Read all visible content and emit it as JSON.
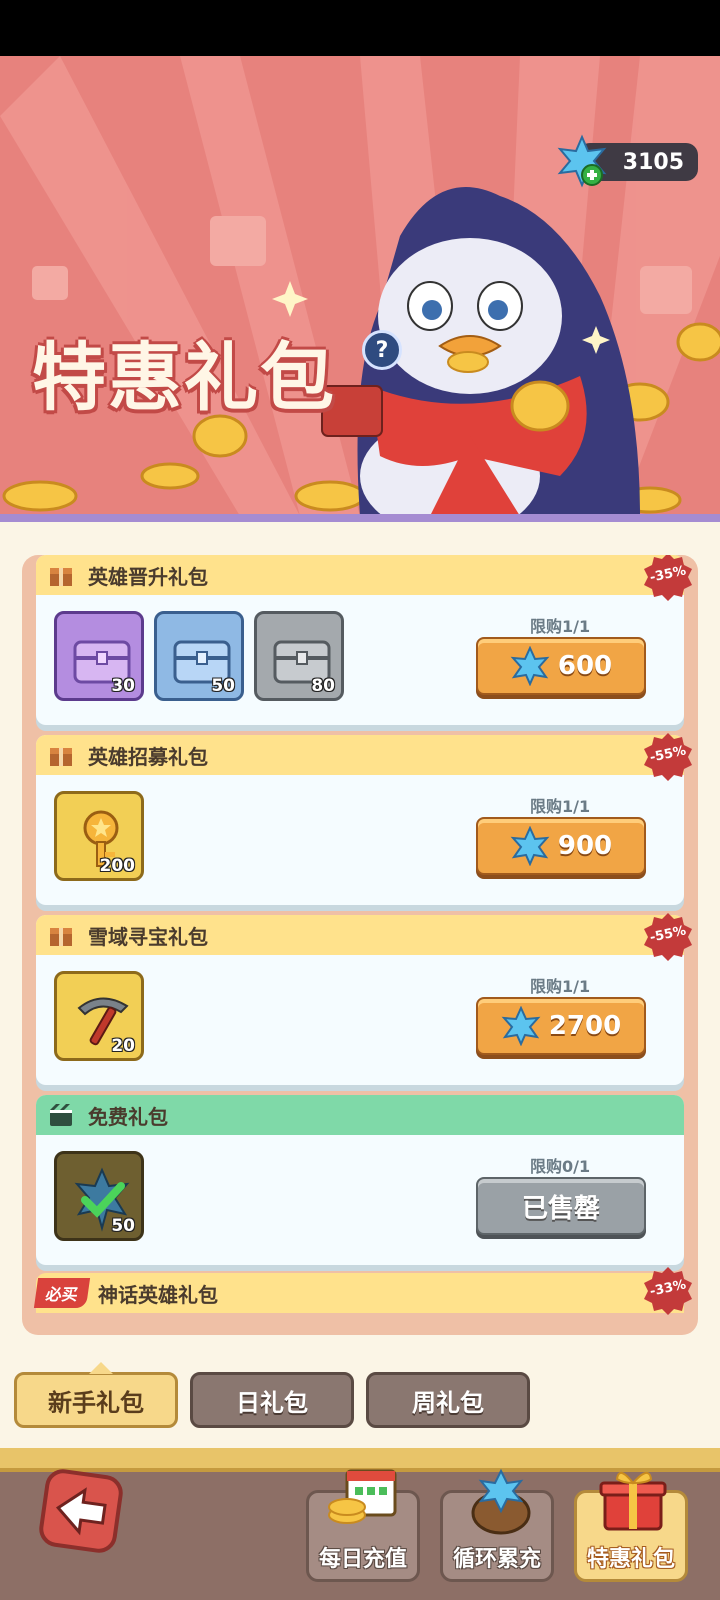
{
  "header": {
    "currency_amount": "3105",
    "title": "特惠礼包"
  },
  "packs": [
    {
      "name": "英雄晋升礼包",
      "discount": "-35%",
      "limit": "限购1/1",
      "price": "600",
      "items": [
        {
          "icon": "purple-chest-icon",
          "count": "30"
        },
        {
          "icon": "blue-chest-icon",
          "count": "50"
        },
        {
          "icon": "gray-chest-icon",
          "count": "80"
        }
      ]
    },
    {
      "name": "英雄招募礼包",
      "discount": "-55%",
      "limit": "限购1/1",
      "price": "900",
      "items": [
        {
          "icon": "gold-key-icon",
          "count": "200"
        }
      ]
    },
    {
      "name": "雪域寻宝礼包",
      "discount": "-55%",
      "limit": "限购1/1",
      "price": "2700",
      "items": [
        {
          "icon": "pickaxe-icon",
          "count": "20"
        }
      ]
    },
    {
      "name": "免费礼包",
      "limit": "限购0/1",
      "price": "已售罄",
      "items": [
        {
          "icon": "gem-claimed-icon",
          "count": "50"
        }
      ]
    },
    {
      "name": "神话英雄礼包",
      "tag": "必买",
      "discount": "-33%"
    }
  ],
  "tabs": [
    {
      "label": "新手礼包",
      "active": true
    },
    {
      "label": "日礼包"
    },
    {
      "label": "周礼包"
    }
  ],
  "bottom_nav": [
    {
      "label": "每日充值"
    },
    {
      "label": "循环累充"
    },
    {
      "label": "特惠礼包",
      "active": true
    }
  ],
  "colors": {
    "banner": "#e7827d",
    "button_orange": "#f1a545",
    "header_yellow": "#ffe28c",
    "header_green": "#7fd9a8"
  }
}
